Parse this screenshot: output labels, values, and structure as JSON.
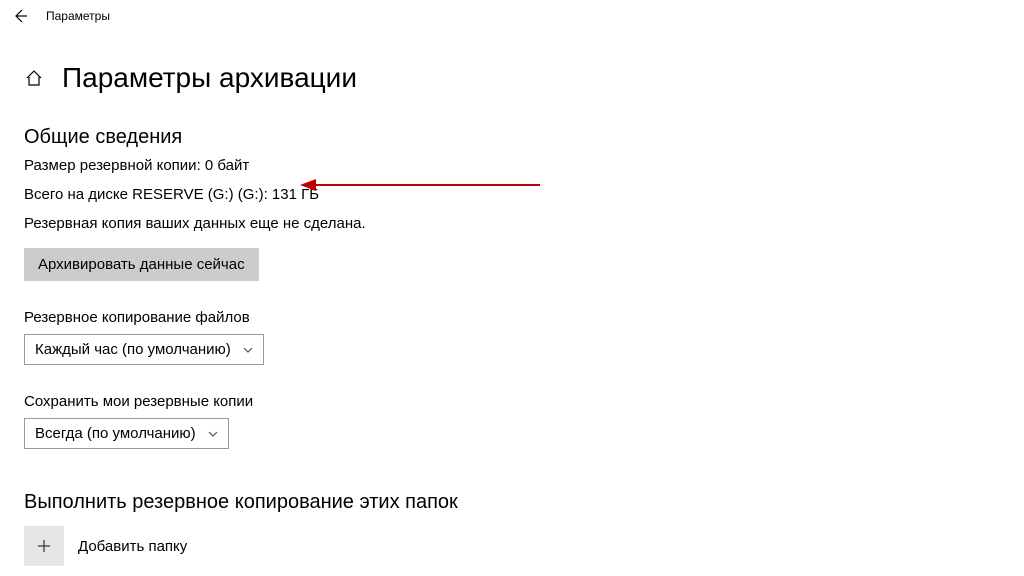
{
  "titlebar": {
    "app": "Параметры"
  },
  "page": {
    "title": "Параметры архивации"
  },
  "overview": {
    "heading": "Общие сведения",
    "size": "Размер резервной копии: 0 байт",
    "disk": "Всего на диске RESERVE (G:) (G:): 131 ГБ",
    "status": "Резервная копия ваших данных еще не сделана.",
    "backup_now": "Архивировать данные сейчас"
  },
  "schedule": {
    "label": "Резервное копирование файлов",
    "value": "Каждый час (по умолчанию)"
  },
  "retention": {
    "label": "Сохранить мои резервные копии",
    "value": "Всегда (по умолчанию)"
  },
  "folders": {
    "heading": "Выполнить резервное копирование этих папок",
    "add": "Добавить папку"
  }
}
